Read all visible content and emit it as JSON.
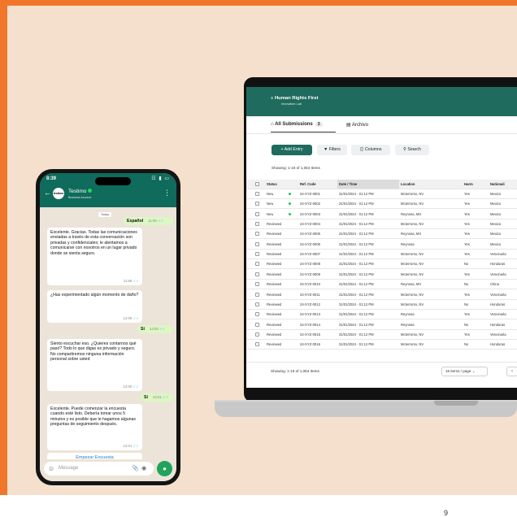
{
  "page_number": "9",
  "colors": {
    "frame": "#f0762a",
    "panel": "#f4e0cc",
    "brand_green": "#1f6b5e",
    "wa_green": "#0f6b5b",
    "out_bubble": "#dcf6c4"
  },
  "phone": {
    "status_time": "8:39",
    "status_icons": "wifi-icon signal-icon battery-icon",
    "contact_name": "Testimo",
    "contact_sub": "Business Account",
    "avatar_text": "testimo",
    "day_label": "Today",
    "messages": [
      {
        "dir": "out",
        "text": "Español",
        "time": "11:00"
      },
      {
        "dir": "in",
        "text": "Excelente. Gracias. Todas las comunicaciones enviadas a través de esta conversación son privadas y confidenciales; le alentamos a comunicarse con nosotros en un lugar privado donde se sienta seguro.",
        "time": "11:58"
      },
      {
        "dir": "in",
        "text": "¿Has experimentado algún momento de daño?",
        "time": "12:00"
      },
      {
        "dir": "out",
        "text": "Sí",
        "time": "12:00"
      },
      {
        "dir": "in",
        "text": "Siento escuchar eso. ¿Quieres contarnos qué pasó? Todo lo que digas es privado y seguro. No compartiremos ninguna información personal sobre usted",
        "time": "12:00"
      },
      {
        "dir": "out",
        "text": "Sí",
        "time": "12:01"
      },
      {
        "dir": "in",
        "text": "Excelente. Puede comenzar la encuesta cuando esté listo. Debería tomar unos 5 minutos y es posible que le hagamos algunas preguntas de seguimiento después.",
        "time": "12:01"
      }
    ],
    "survey_button": "Empezar Encuesta",
    "composer_placeholder": "Message"
  },
  "laptop": {
    "brand": "Human Rights First",
    "brand_sub": "Innovation Lab",
    "tabs": [
      {
        "label": "All Submissions",
        "count": "3"
      },
      {
        "label": "Archivo"
      }
    ],
    "toolbar": {
      "add": "+ Add Entry",
      "filters": "Filters",
      "columns": "Columns",
      "search": "Search"
    },
    "showing": "Showing: 1-16 of 1,064 Items",
    "columns": [
      "Status",
      "Ref. Code",
      "Date / Time",
      "Location",
      "Harm",
      "Nationali"
    ],
    "rows": [
      [
        "New",
        "24-XYZ-0001",
        "31/01/2024 · 01:12 PM",
        "Mcterrorso, NV",
        "Yes",
        "Mexico"
      ],
      [
        "New",
        "24-XYZ-0002",
        "31/01/2024 · 01:12 PM",
        "Mcterrorso, NV",
        "Yes",
        "Mexico"
      ],
      [
        "New",
        "24-XYZ-0003",
        "31/01/2024 · 01:12 PM",
        "Reynosa, MX",
        "Yes",
        "Mexico"
      ],
      [
        "Reviewed",
        "24-XYZ-0004",
        "31/01/2024 · 01:12 PM",
        "Mcterrorso, NV",
        "Yes",
        "Mexico"
      ],
      [
        "Reviewed",
        "24-XYZ-0005",
        "31/01/2024 · 01:12 PM",
        "Reynosa, MX",
        "Yes",
        "Mexico"
      ],
      [
        "Reviewed",
        "24-XYZ-0006",
        "31/01/2024 · 01:12 PM",
        "Reynosa",
        "Yes",
        "Mexico"
      ],
      [
        "Reviewed",
        "24-XYZ-0007",
        "31/01/2024 · 01:12 PM",
        "Mcterrorso, NV",
        "Yes",
        "Venezuela"
      ],
      [
        "Reviewed",
        "24-XYZ-0008",
        "31/01/2024 · 01:12 PM",
        "Mcterrorso, NV",
        "No",
        "Honduras"
      ],
      [
        "Reviewed",
        "24-XYZ-0009",
        "31/01/2024 · 01:12 PM",
        "Mcterrorso, NV",
        "Yes",
        "Venezuela"
      ],
      [
        "Reviewed",
        "24-XYZ-0010",
        "31/01/2024 · 01:12 PM",
        "Reynosa, MX",
        "No",
        "China"
      ],
      [
        "Reviewed",
        "24-XYZ-0011",
        "31/01/2024 · 01:12 PM",
        "Mcterrorso, NV",
        "Yes",
        "Venezuela"
      ],
      [
        "Reviewed",
        "24-XYZ-0012",
        "31/01/2024 · 01:12 PM",
        "Mcterrorso, NV",
        "No",
        "Honduras"
      ],
      [
        "Reviewed",
        "24-XYZ-0013",
        "31/01/2024 · 01:12 PM",
        "Reynosa",
        "Yes",
        "Venezuela"
      ],
      [
        "Reviewed",
        "24-XYZ-0014",
        "31/01/2024 · 01:12 PM",
        "Reynosa",
        "No",
        "Honduras"
      ],
      [
        "Reviewed",
        "24-XYZ-0015",
        "31/01/2024 · 01:12 PM",
        "Mcterrorso, NV",
        "Yes",
        "Venezuela"
      ],
      [
        "Reviewed",
        "24-XYZ-0016",
        "31/01/2024 · 01:12 PM",
        "Mcterrorso, NV",
        "No",
        "Honduras"
      ]
    ],
    "per_page": "16 items / page"
  }
}
